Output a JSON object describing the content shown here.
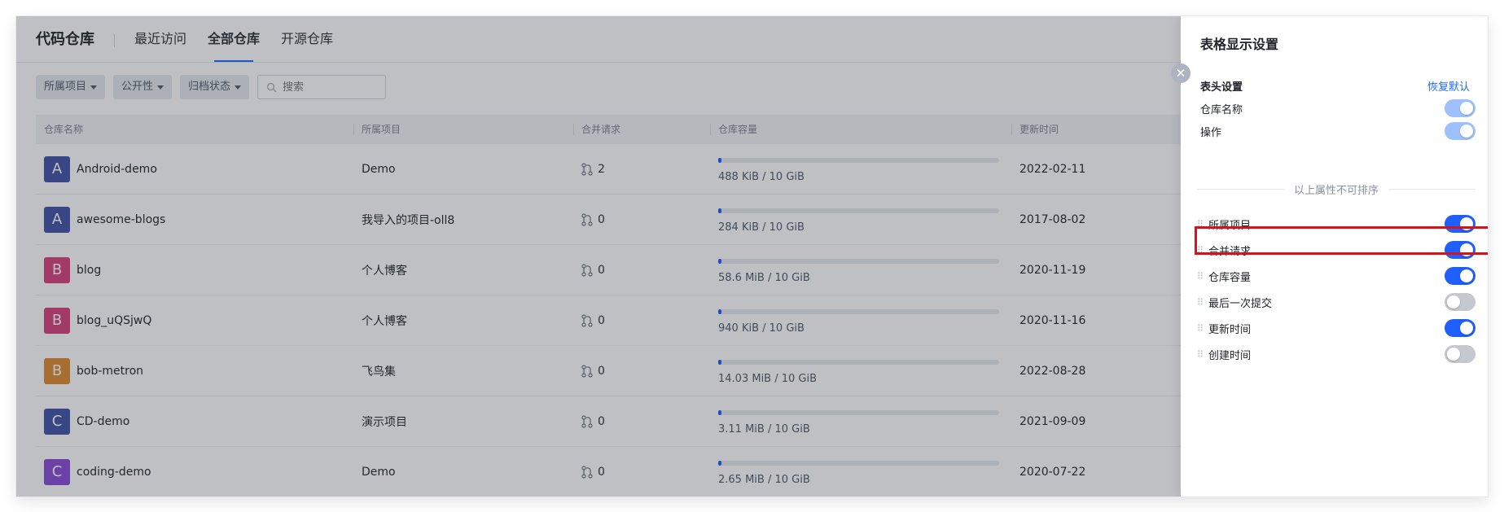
{
  "header": {
    "brand": "代码仓库",
    "tabs": [
      {
        "label": "最近访问",
        "active": false
      },
      {
        "label": "全部仓库",
        "active": true
      },
      {
        "label": "开源仓库",
        "active": false
      }
    ]
  },
  "filters": {
    "project": "所属项目",
    "visibility": "公开性",
    "archive": "归档状态",
    "search_placeholder": "搜索"
  },
  "table": {
    "columns": [
      "仓库名称",
      "所属项目",
      "合并请求",
      "仓库容量",
      "更新时间"
    ],
    "rows": [
      {
        "initial": "A",
        "color": "#3f51a6",
        "name": "Android-demo",
        "project": "Demo",
        "mr": "2",
        "capacity": "488 KiB / 10 GiB",
        "fill": 0.01,
        "updated": "2022-02-11"
      },
      {
        "initial": "A",
        "color": "#3f51a6",
        "name": "awesome-blogs",
        "project": "我导入的项目-oll8",
        "mr": "0",
        "capacity": "284 KiB / 10 GiB",
        "fill": 0.01,
        "updated": "2017-08-02"
      },
      {
        "initial": "B",
        "color": "#d6407c",
        "name": "blog",
        "project": "个人博客",
        "mr": "0",
        "capacity": "58.6 MiB / 10 GiB",
        "fill": 0.01,
        "updated": "2020-11-19"
      },
      {
        "initial": "B",
        "color": "#d6407c",
        "name": "blog_uQSjwQ",
        "project": "个人博客",
        "mr": "0",
        "capacity": "940 KiB / 10 GiB",
        "fill": 0.01,
        "updated": "2020-11-16"
      },
      {
        "initial": "B",
        "color": "#e08a2e",
        "name": "bob-metron",
        "project": "飞鸟集",
        "mr": "0",
        "capacity": "14.03 MiB / 10 GiB",
        "fill": 0.01,
        "updated": "2022-08-28"
      },
      {
        "initial": "C",
        "color": "#3f51a6",
        "name": "CD-demo",
        "project": "演示项目",
        "mr": "0",
        "capacity": "3.11 MiB / 10 GiB",
        "fill": 0.01,
        "updated": "2021-09-09"
      },
      {
        "initial": "C",
        "color": "#8a4ad6",
        "name": "coding-demo",
        "project": "Demo",
        "mr": "0",
        "capacity": "2.65 MiB / 10 GiB",
        "fill": 0.01,
        "updated": "2020-07-22"
      }
    ]
  },
  "drawer": {
    "title": "表格显示设置",
    "section": "表头设置",
    "reset": "恢复默认",
    "fixed_items": [
      {
        "label": "仓库名称",
        "state": "disabled-on"
      },
      {
        "label": "操作",
        "state": "disabled-on"
      }
    ],
    "divider_text": "以上属性不可排序",
    "items": [
      {
        "label": "所属项目",
        "on": true
      },
      {
        "label": "合并请求",
        "on": true
      },
      {
        "label": "仓库容量",
        "on": true
      },
      {
        "label": "最后一次提交",
        "on": false
      },
      {
        "label": "更新时间",
        "on": true
      },
      {
        "label": "创建时间",
        "on": false
      }
    ]
  },
  "icons": {
    "close": "close-icon",
    "search": "search-icon",
    "merge": "merge-request-icon",
    "drag": "drag-handle-icon"
  }
}
